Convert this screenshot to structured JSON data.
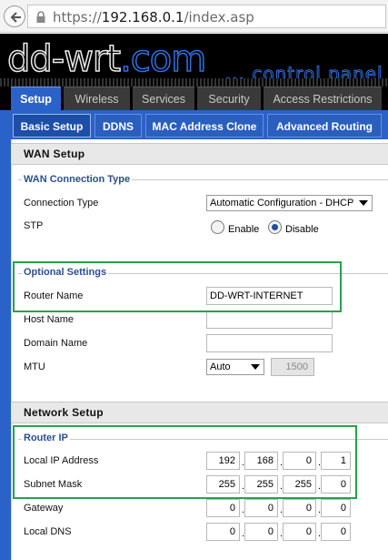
{
  "browser": {
    "url_prefix": "https://",
    "url_host": "192.168.0.1",
    "url_path": "/index.asp"
  },
  "brand": {
    "logo_main": "dd-wrt",
    "logo_suffix": ".com",
    "tagline": "... control panel"
  },
  "tabs": [
    {
      "label": "Setup",
      "active": true
    },
    {
      "label": "Wireless"
    },
    {
      "label": "Services"
    },
    {
      "label": "Security"
    },
    {
      "label": "Access Restrictions"
    }
  ],
  "subtabs": [
    {
      "label": "Basic Setup",
      "active": true
    },
    {
      "label": "DDNS"
    },
    {
      "label": "MAC Address Clone"
    },
    {
      "label": "Advanced Routing"
    }
  ],
  "wan": {
    "title": "WAN Setup",
    "legend": "WAN Connection Type",
    "connection_type_label": "Connection Type",
    "connection_type_value": "Automatic Configuration - DHCP",
    "stp_label": "STP",
    "stp_enable": "Enable",
    "stp_disable": "Disable",
    "stp_selected": "Disable"
  },
  "optional": {
    "legend": "Optional Settings",
    "router_name_label": "Router Name",
    "router_name_value": "DD-WRT-INTERNET",
    "host_name_label": "Host Name",
    "host_name_value": "",
    "domain_name_label": "Domain Name",
    "domain_name_value": "",
    "mtu_label": "MTU",
    "mtu_mode": "Auto",
    "mtu_value": "1500"
  },
  "network": {
    "title": "Network Setup",
    "legend": "Router IP",
    "local_ip_label": "Local IP Address",
    "local_ip": [
      "192",
      "168",
      "0",
      "1"
    ],
    "subnet_label": "Subnet Mask",
    "subnet": [
      "255",
      "255",
      "255",
      "0"
    ],
    "gateway_label": "Gateway",
    "gateway": [
      "0",
      "0",
      "0",
      "0"
    ],
    "local_dns_label": "Local DNS",
    "local_dns": [
      "0",
      "0",
      "0",
      "0"
    ]
  },
  "colors": {
    "accent": "#2b62c9",
    "highlight": "#27a24a",
    "header_bg": "#000000"
  }
}
